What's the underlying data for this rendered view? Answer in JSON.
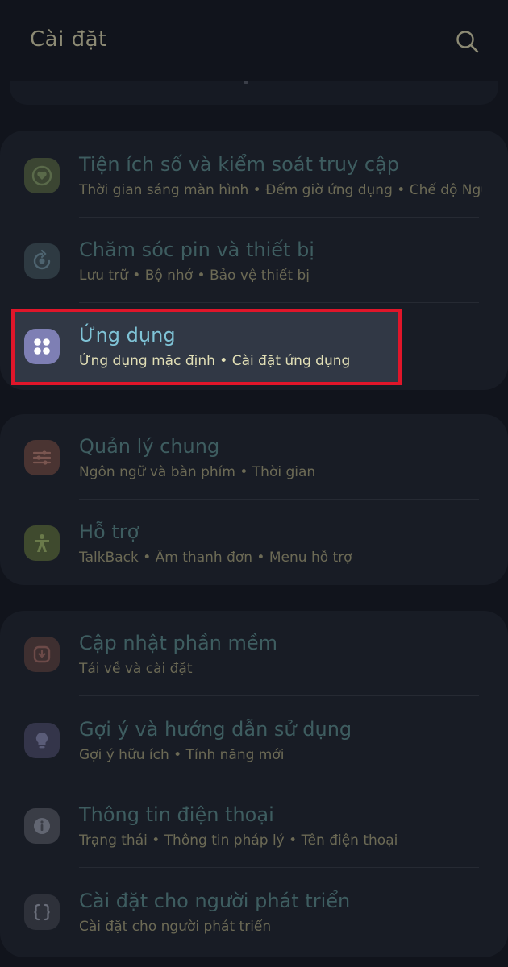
{
  "header": {
    "title": "Cài đặt"
  },
  "icons": {
    "search": "search-icon",
    "digital_wellbeing": "heart-circle-icon",
    "battery_care": "refresh-cycle-icon",
    "apps": "four-dots-apps-icon",
    "general": "sliders-icon",
    "accessibility": "person-accessibility-icon",
    "software_update": "update-icon",
    "tips": "lightbulb-icon",
    "about": "info-icon",
    "developer": "curly-braces-icon"
  },
  "colors": {
    "highlight_border": "#e0162a",
    "active_title": "#7fc3d6",
    "active_subtitle": "#e2dfb6"
  },
  "groups": [
    {
      "items": [
        {
          "title": "Tiện ích số và kiểm soát truy cập",
          "subtitle": "Thời gian sáng màn hình  •  Đếm giờ ứng dụng  •  Chế độ Ngủ"
        },
        {
          "title": "Chăm sóc pin và thiết bị",
          "subtitle": "Lưu trữ  •  Bộ nhớ  •  Bảo vệ thiết bị"
        },
        {
          "title": "Ứng dụng",
          "subtitle": "Ứng dụng mặc định  •  Cài đặt ứng dụng"
        }
      ]
    },
    {
      "items": [
        {
          "title": "Quản lý chung",
          "subtitle": "Ngôn ngữ và bàn phím  •  Thời gian"
        },
        {
          "title": "Hỗ trợ",
          "subtitle": "TalkBack  •  Âm thanh đơn  •  Menu hỗ trợ"
        }
      ]
    },
    {
      "items": [
        {
          "title": "Cập nhật phần mềm",
          "subtitle": "Tải về và cài đặt"
        },
        {
          "title": "Gợi ý và hướng dẫn sử dụng",
          "subtitle": "Gợi ý hữu ích  •  Tính năng mới"
        },
        {
          "title": "Thông tin điện thoại",
          "subtitle": "Trạng thái  •  Thông tin pháp lý  •  Tên điện thoại"
        },
        {
          "title": "Cài đặt cho người phát triển",
          "subtitle": "Cài đặt cho người phát triển"
        }
      ]
    }
  ]
}
